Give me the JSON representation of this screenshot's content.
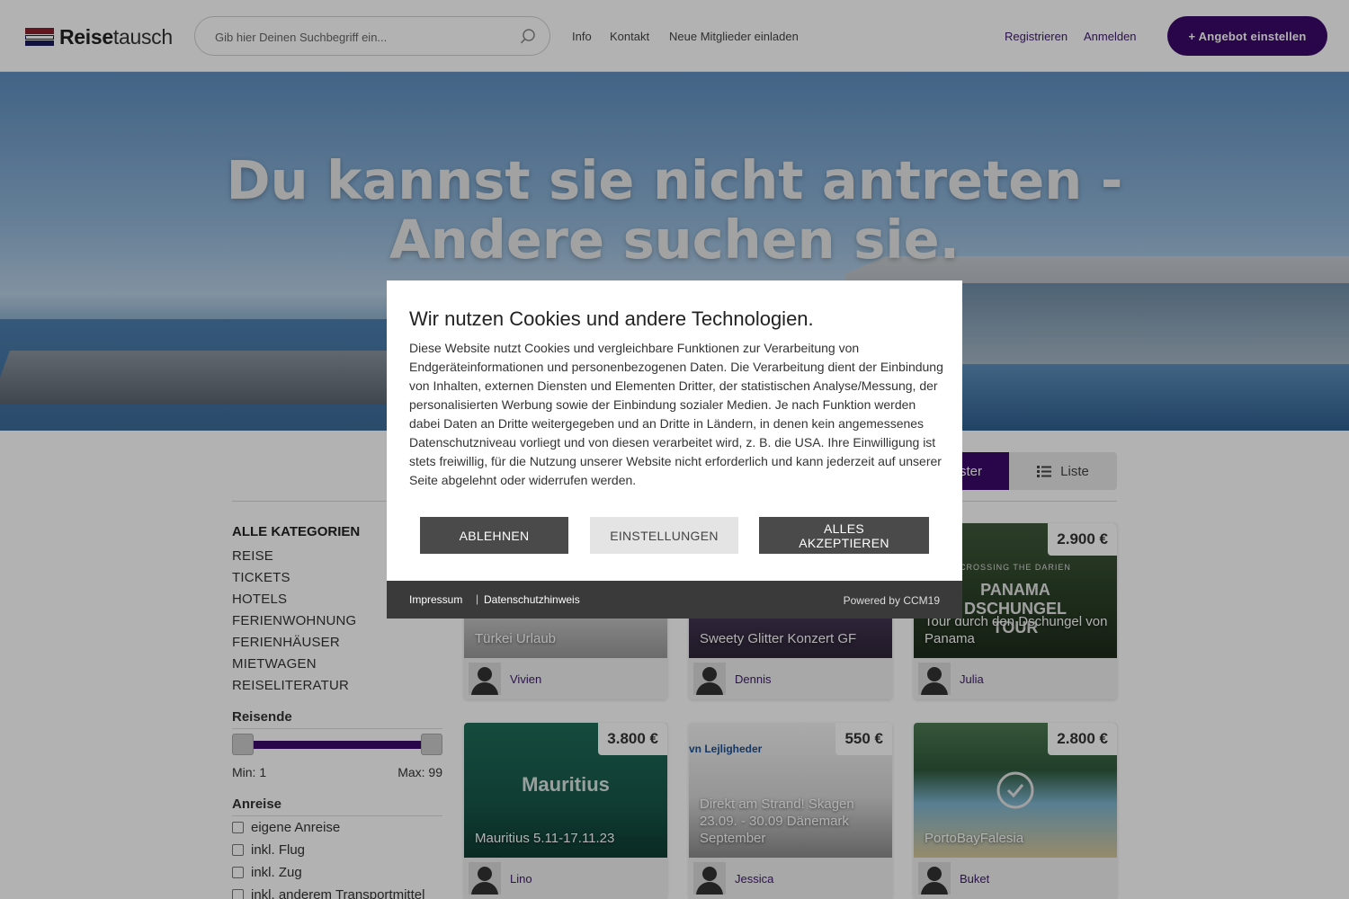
{
  "header": {
    "logo_bold": "Reise",
    "logo_rest": "tausch",
    "search_placeholder": "Gib hier Deinen Suchbegriff ein...",
    "nav": [
      "Info",
      "Kontakt",
      "Neue Mitglieder einladen"
    ],
    "register": "Registrieren",
    "login": "Anmelden",
    "cta": "+ Angebot einstellen"
  },
  "hero": {
    "title": "Du kannst sie nicht antreten - Andere suchen sie."
  },
  "view_toggle": {
    "grid_label": "Raster",
    "list_label": "Liste"
  },
  "sidebar": {
    "all_categories": "ALLE KATEGORIEN",
    "categories": [
      "REISE",
      "TICKETS",
      "HOTELS",
      "FERIENWOHNUNG",
      "FERIENHÄUSER",
      "MIETWAGEN",
      "REISELITERATUR"
    ],
    "travellers_title": "Reisende",
    "min_label": "Min: 1",
    "max_label": "Max: 99",
    "arrival_title": "Anreise",
    "arrival_options": [
      "eigene Anreise",
      "inkl. Flug",
      "inkl. Zug",
      "inkl. anderem Transportmittel"
    ]
  },
  "listings": [
    {
      "title": "Türkei Urlaub",
      "price": "",
      "user": "Vivien"
    },
    {
      "title": "Sweety Glitter Konzert GF",
      "price": "",
      "user": "Dennis"
    },
    {
      "title": "Tour durch den Dschungel von Panama",
      "price": "2.900 €",
      "user": "Julia",
      "image_text": "PANAMA DSCHUNGEL TOUR",
      "image_subtext": "CROSSING THE DARIEN"
    },
    {
      "title": "Mauritius 5.11-17.11.23",
      "price": "3.800 €",
      "user": "Lino",
      "image_text": "Mauritius"
    },
    {
      "title": "Direkt am Strand! Skagen 23.09. - 30.09 Dänemark September",
      "price": "550 €",
      "user": "Jessica",
      "image_text": "vn Lejligheder"
    },
    {
      "title": "PortoBayFalesia",
      "price": "2.800 €",
      "user": "Buket"
    }
  ],
  "cookie": {
    "title": "Wir nutzen Cookies und andere Technologien.",
    "text": "Diese Website nutzt Cookies und vergleichbare Funktionen zur Verarbeitung von Endgeräteinformationen und personenbezogenen Daten. Die Verarbeitung dient der Einbindung von Inhalten, externen Diensten und Elementen Dritter, der statistischen Analyse/Messung, der personalisierten Werbung sowie der Einbindung sozialer Medien. Je nach Funktion werden dabei Daten an Dritte weitergegeben und an Dritte in Ländern, in denen kein angemessenes Datenschutzniveau vorliegt und von diesen verarbeitet wird, z. B. die USA. Ihre Einwilligung ist stets freiwillig, für die Nutzung unserer Website nicht erforderlich und kann jederzeit auf unserer Seite abgelehnt oder widerrufen werden.",
    "decline": "ABLEHNEN",
    "settings": "EINSTELLUNGEN",
    "accept_all": "ALLES AKZEPTIEREN",
    "imprint": "Impressum",
    "privacy": "Datenschutzhinweis",
    "powered": "Powered by CCM19"
  },
  "colors": {
    "brand_purple": "#3b0a6b",
    "cookie_footer": "#3a3a3a"
  }
}
